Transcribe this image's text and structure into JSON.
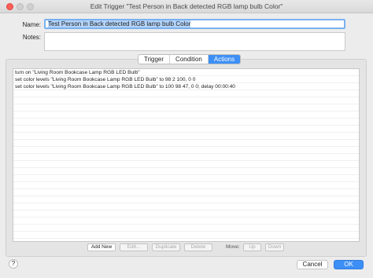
{
  "window": {
    "title": "Edit Trigger \"Test Person in Back detected RGB lamp bulb Color\""
  },
  "form": {
    "name_label": "Name:",
    "name_value": "Test Person in Back detected RGB lamp bulb Color",
    "notes_label": "Notes:",
    "notes_value": ""
  },
  "tabs": [
    {
      "label": "Trigger",
      "active": false
    },
    {
      "label": "Condition",
      "active": false
    },
    {
      "label": "Actions",
      "active": true
    }
  ],
  "actions": [
    "turn on \"Living Room Bookcase Lamp RGB LED Bulb\"",
    "set color levels \"Living Room Bookcase Lamp RGB LED Bulb\" to 98 2 100, 0 0",
    "set color levels \"Living Room Bookcase Lamp RGB LED Bulb\" to 100 98 47, 0 0; delay 00:00:40"
  ],
  "list_buttons": {
    "add": "Add New",
    "edit": "Edit...",
    "duplicate": "Duplicate",
    "delete": "Delete",
    "move_label": "Move:",
    "up": "Up",
    "down": "Down"
  },
  "footer": {
    "help": "?",
    "cancel": "Cancel",
    "ok": "OK"
  },
  "colors": {
    "accent": "#3d8ff6",
    "close": "#ff5f57"
  }
}
